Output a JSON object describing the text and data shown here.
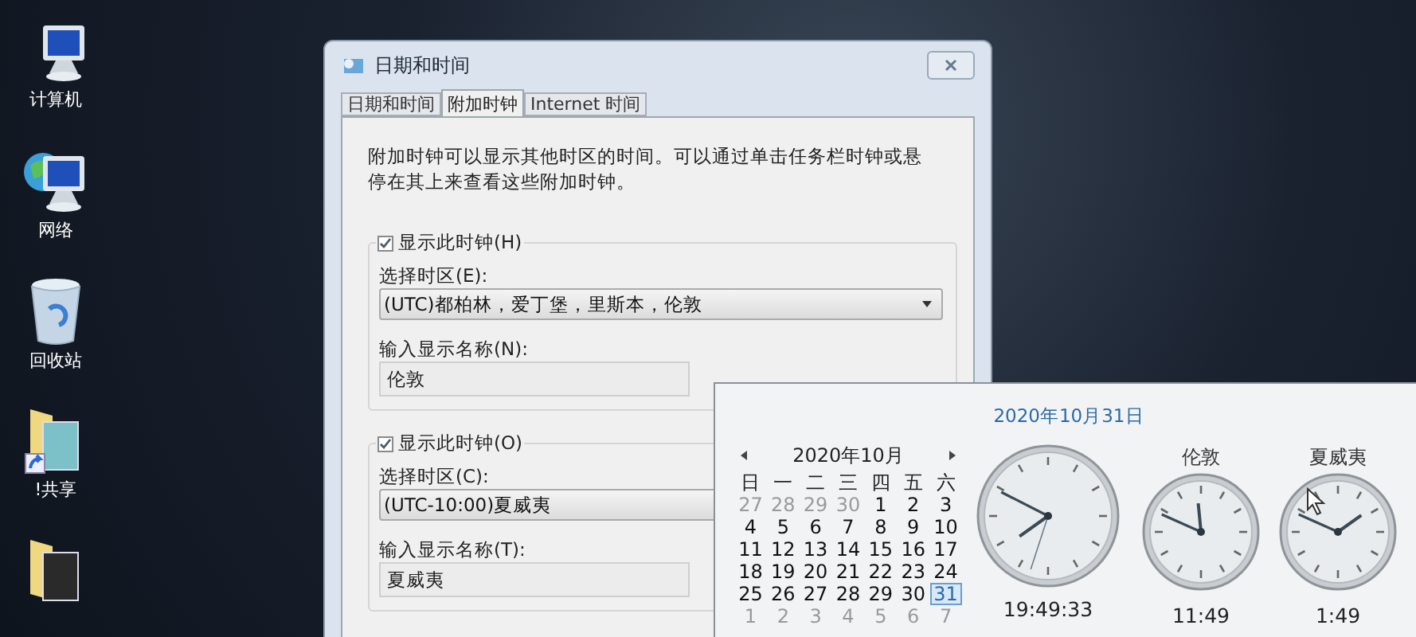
{
  "desktop_icons": [
    {
      "label": "计算机",
      "kind": "computer"
    },
    {
      "label": "网络",
      "kind": "network"
    },
    {
      "label": "回收站",
      "kind": "recycle"
    },
    {
      "label": "!共享",
      "kind": "shortcut-folder"
    },
    {
      "kind": "folder"
    }
  ],
  "dialog": {
    "title": "日期和时间",
    "tabs": [
      {
        "label": "日期和时间",
        "selected": false
      },
      {
        "label": "附加时钟",
        "selected": true
      },
      {
        "label": "Internet 时间",
        "selected": false
      }
    ],
    "description": "附加时钟可以显示其他时区的时间。可以通过单击任务栏时钟或悬停在其上来查看这些附加时钟。",
    "clocks": [
      {
        "show_label": "显示此时钟(H)",
        "checked": true,
        "timezone_label": "选择时区(E):",
        "timezone": "(UTC)都柏林，爱丁堡，里斯本，伦敦",
        "name_label": "输入显示名称(N):",
        "name": "伦敦"
      },
      {
        "show_label": "显示此时钟(O)",
        "checked": true,
        "timezone_label": "选择时区(C):",
        "timezone": "(UTC-10:00)夏威夷",
        "name_label": "输入显示名称(T):",
        "name": "夏威夷"
      }
    ]
  },
  "popup": {
    "date": "2020年10月31日",
    "calendar": {
      "month": "2020年10月",
      "weekdays": [
        "日",
        "一",
        "二",
        "三",
        "四",
        "五",
        "六"
      ],
      "weeks": [
        [
          {
            "day": "27",
            "other_month": true,
            "selected": false
          },
          {
            "day": "28",
            "other_month": true,
            "selected": false
          },
          {
            "day": "29",
            "other_month": true,
            "selected": false
          },
          {
            "day": "30",
            "other_month": true,
            "selected": false
          },
          {
            "day": "1",
            "other_month": false,
            "selected": false
          },
          {
            "day": "2",
            "other_month": false,
            "selected": false
          },
          {
            "day": "3",
            "other_month": false,
            "selected": false
          }
        ],
        [
          {
            "day": "4",
            "other_month": false,
            "selected": false
          },
          {
            "day": "5",
            "other_month": false,
            "selected": false
          },
          {
            "day": "6",
            "other_month": false,
            "selected": false
          },
          {
            "day": "7",
            "other_month": false,
            "selected": false
          },
          {
            "day": "8",
            "other_month": false,
            "selected": false
          },
          {
            "day": "9",
            "other_month": false,
            "selected": false
          },
          {
            "day": "10",
            "other_month": false,
            "selected": false
          }
        ],
        [
          {
            "day": "11",
            "other_month": false,
            "selected": false
          },
          {
            "day": "12",
            "other_month": false,
            "selected": false
          },
          {
            "day": "13",
            "other_month": false,
            "selected": false
          },
          {
            "day": "14",
            "other_month": false,
            "selected": false
          },
          {
            "day": "15",
            "other_month": false,
            "selected": false
          },
          {
            "day": "16",
            "other_month": false,
            "selected": false
          },
          {
            "day": "17",
            "other_month": false,
            "selected": false
          }
        ],
        [
          {
            "day": "18",
            "other_month": false,
            "selected": false
          },
          {
            "day": "19",
            "other_month": false,
            "selected": false
          },
          {
            "day": "20",
            "other_month": false,
            "selected": false
          },
          {
            "day": "21",
            "other_month": false,
            "selected": false
          },
          {
            "day": "22",
            "other_month": false,
            "selected": false
          },
          {
            "day": "23",
            "other_month": false,
            "selected": false
          },
          {
            "day": "24",
            "other_month": false,
            "selected": false
          }
        ],
        [
          {
            "day": "25",
            "other_month": false,
            "selected": false
          },
          {
            "day": "26",
            "other_month": false,
            "selected": false
          },
          {
            "day": "27",
            "other_month": false,
            "selected": false
          },
          {
            "day": "28",
            "other_month": false,
            "selected": false
          },
          {
            "day": "29",
            "other_month": false,
            "selected": false
          },
          {
            "day": "30",
            "other_month": false,
            "selected": false
          },
          {
            "day": "31",
            "other_month": false,
            "selected": true
          }
        ],
        [
          {
            "day": "1",
            "other_month": true,
            "selected": false
          },
          {
            "day": "2",
            "other_month": true,
            "selected": false
          },
          {
            "day": "3",
            "other_month": true,
            "selected": false
          },
          {
            "day": "4",
            "other_month": true,
            "selected": false
          },
          {
            "day": "5",
            "other_month": true,
            "selected": false
          },
          {
            "day": "6",
            "other_month": true,
            "selected": false
          },
          {
            "day": "7",
            "other_month": true,
            "selected": false
          }
        ]
      ]
    },
    "clocks": [
      {
        "kind": "main",
        "time": "19:49:33"
      },
      {
        "kind": "extra",
        "label": "伦敦",
        "time": "11:49"
      },
      {
        "kind": "extra",
        "label": "夏威夷",
        "time": "1:49"
      }
    ]
  }
}
